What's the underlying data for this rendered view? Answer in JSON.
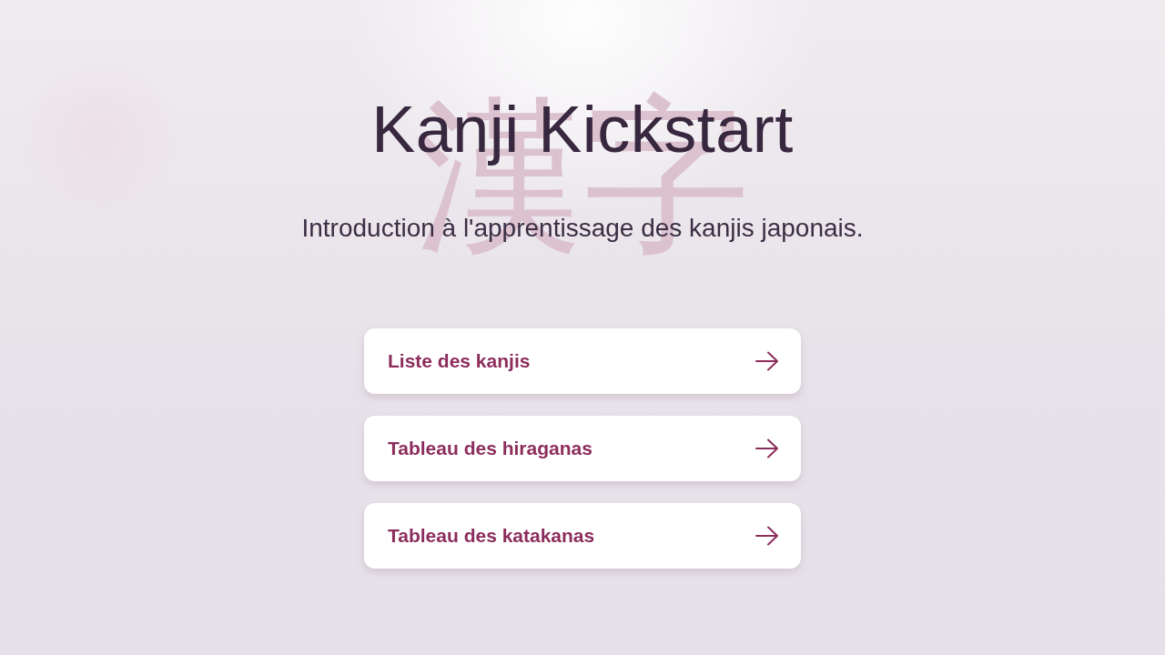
{
  "background_kanji": "漢字",
  "title": "Kanji Kickstart",
  "subtitle": "Introduction à l'apprentissage des kanjis japonais.",
  "links": [
    {
      "label": "Liste des kanjis"
    },
    {
      "label": "Tableau des hiraganas"
    },
    {
      "label": "Tableau des katakanas"
    }
  ]
}
